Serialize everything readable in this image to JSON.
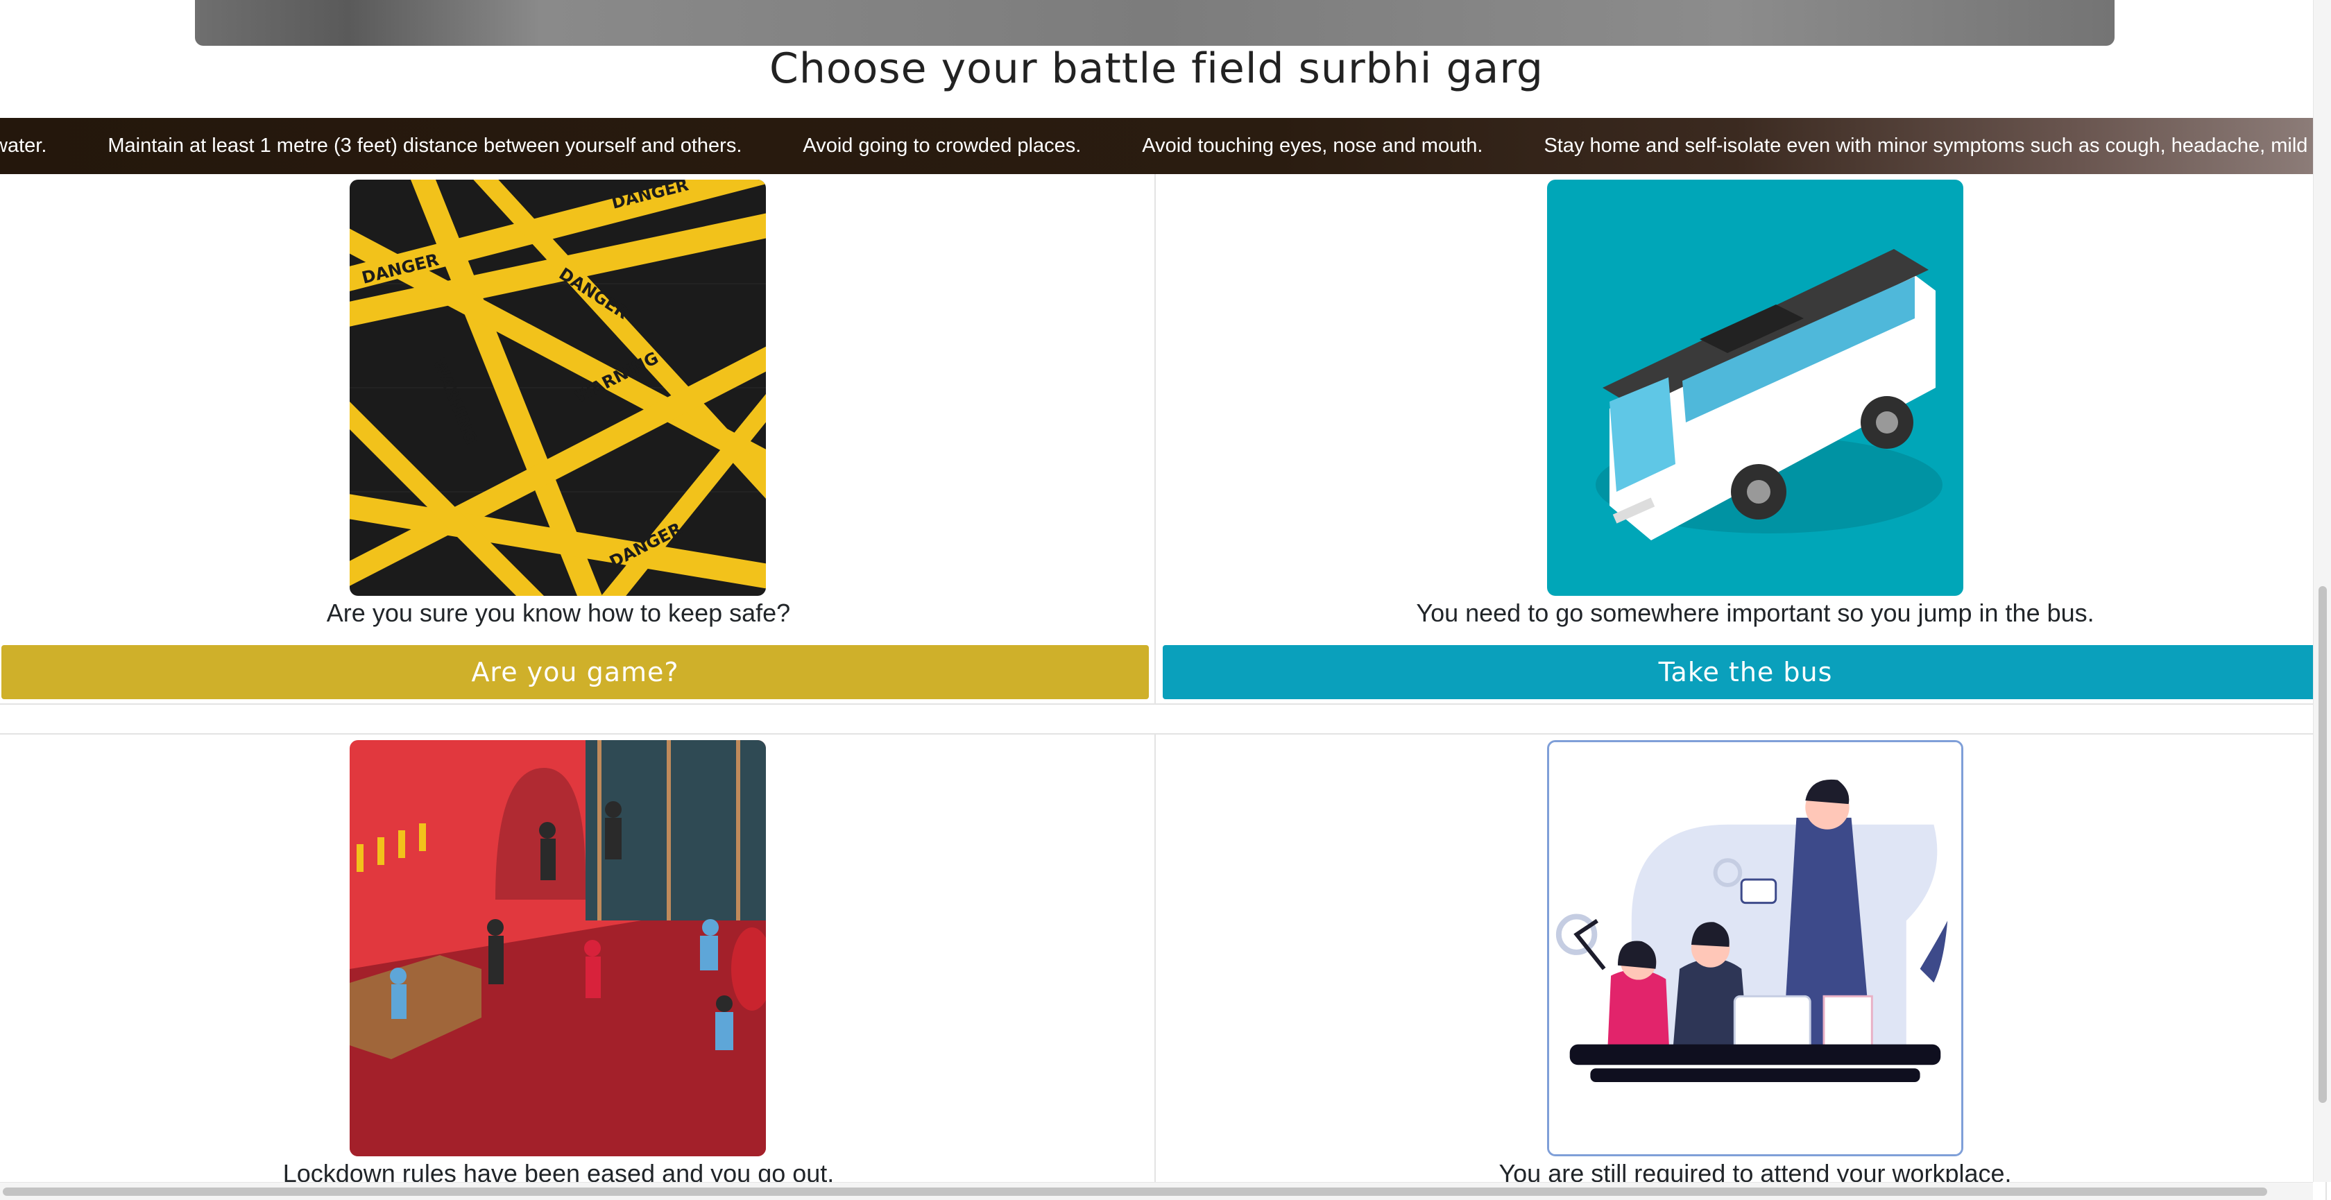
{
  "title": "Choose your battle field surbhi garg",
  "ticker": [
    "water.",
    "Maintain at least 1 metre (3 feet) distance between yourself and others.",
    "Avoid going to crowded places.",
    "Avoid touching eyes, nose and mouth.",
    "Stay home and self-isolate even with minor symptoms such as cough, headache, mild fever, until you recover."
  ],
  "cards": [
    {
      "caption": "Are you sure you know how to keep safe?",
      "button": "Are you game?",
      "image": "danger-tape-image",
      "color": "#cfb02a"
    },
    {
      "caption": "You need to go somewhere important so you jump in the bus.",
      "button": "Take the bus",
      "image": "bus-image",
      "color": "#0aa0bc"
    },
    {
      "caption": "Lockdown rules have been eased and you go out.",
      "image": "bar-image"
    },
    {
      "caption": "You are still required to attend your workplace.",
      "image": "office-image"
    }
  ],
  "colors": {
    "tape_yellow": "#f2c21b",
    "bus_bg": "#00a6b8",
    "bar_red": "#e1383e",
    "office_accent": "#3d4a8a"
  }
}
